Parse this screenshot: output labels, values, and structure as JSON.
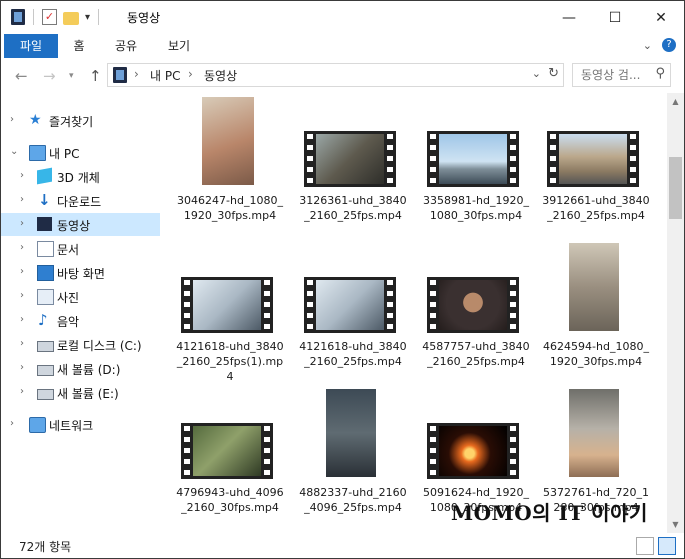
{
  "window": {
    "title": "동영상",
    "controls": {
      "minimize": "—",
      "maximize": "☐",
      "close": "✕"
    }
  },
  "ribbon": {
    "tabs": [
      "파일",
      "홈",
      "공유",
      "보기"
    ]
  },
  "address": {
    "crumbs": [
      "내 PC",
      "동영상"
    ],
    "separator": "›"
  },
  "search": {
    "placeholder": "동영상 검..."
  },
  "nav": {
    "items": [
      {
        "label": "즐겨찾기",
        "icon": "star-icon"
      },
      {
        "label": "내 PC",
        "icon": "computer-icon"
      },
      {
        "label": "3D 개체",
        "icon": "3d-objects-icon"
      },
      {
        "label": "다운로드",
        "icon": "download-icon"
      },
      {
        "label": "동영상",
        "icon": "video-folder-icon",
        "selected": true
      },
      {
        "label": "문서",
        "icon": "document-icon"
      },
      {
        "label": "바탕 화면",
        "icon": "desktop-icon"
      },
      {
        "label": "사진",
        "icon": "pictures-icon"
      },
      {
        "label": "음악",
        "icon": "music-icon"
      },
      {
        "label": "로컬 디스크 (C:)",
        "icon": "drive-icon"
      },
      {
        "label": "새 볼륨 (D:)",
        "icon": "drive-icon"
      },
      {
        "label": "새 볼륨 (E:)",
        "icon": "drive-icon"
      },
      {
        "label": "네트워크",
        "icon": "network-icon"
      }
    ]
  },
  "files": [
    {
      "name": "3046247-hd_1080_1920_30fps.mp4",
      "orientation": "portrait",
      "thumb": "kitten-portrait-thumbnail"
    },
    {
      "name": "3126361-uhd_3840_2160_25fps.mp4",
      "orientation": "landscape",
      "thumb": "man-at-laptop-thumbnail"
    },
    {
      "name": "3358981-hd_1920_1080_30fps.mp4",
      "orientation": "landscape",
      "thumb": "city-skyline-flag-thumbnail"
    },
    {
      "name": "3912661-uhd_3840_2160_25fps.mp4",
      "orientation": "landscape",
      "thumb": "street-buildings-thumbnail"
    },
    {
      "name": "4121618-uhd_3840_2160_25fps(1).mp4",
      "orientation": "landscape",
      "thumb": "lab-microscope-thumbnail"
    },
    {
      "name": "4121618-uhd_3840_2160_25fps.mp4",
      "orientation": "landscape",
      "thumb": "lab-microscope-thumbnail"
    },
    {
      "name": "4587757-uhd_3840_2160_25fps.mp4",
      "orientation": "landscape",
      "thumb": "man-portrait-thumbnail"
    },
    {
      "name": "4624594-hd_1080_1920_30fps.mp4",
      "orientation": "portrait",
      "thumb": "cat-on-rock-thumbnail"
    },
    {
      "name": "4796943-uhd_4096_2160_30fps.mp4",
      "orientation": "landscape",
      "thumb": "bird-on-post-thumbnail"
    },
    {
      "name": "4882337-uhd_2160_4096_25fps.mp4",
      "orientation": "portrait",
      "thumb": "rocky-ground-thumbnail"
    },
    {
      "name": "5091624-hd_1920_1080_30fps.mp4",
      "orientation": "landscape",
      "thumb": "fire-sparks-thumbnail"
    },
    {
      "name": "5372761-hd_720_1280_30fps.mp4",
      "orientation": "portrait",
      "thumb": "kitten-in-hand-thumbnail"
    }
  ],
  "status": {
    "item_count": "72개 항목"
  },
  "watermark": "MOMO의 IT 이야기"
}
